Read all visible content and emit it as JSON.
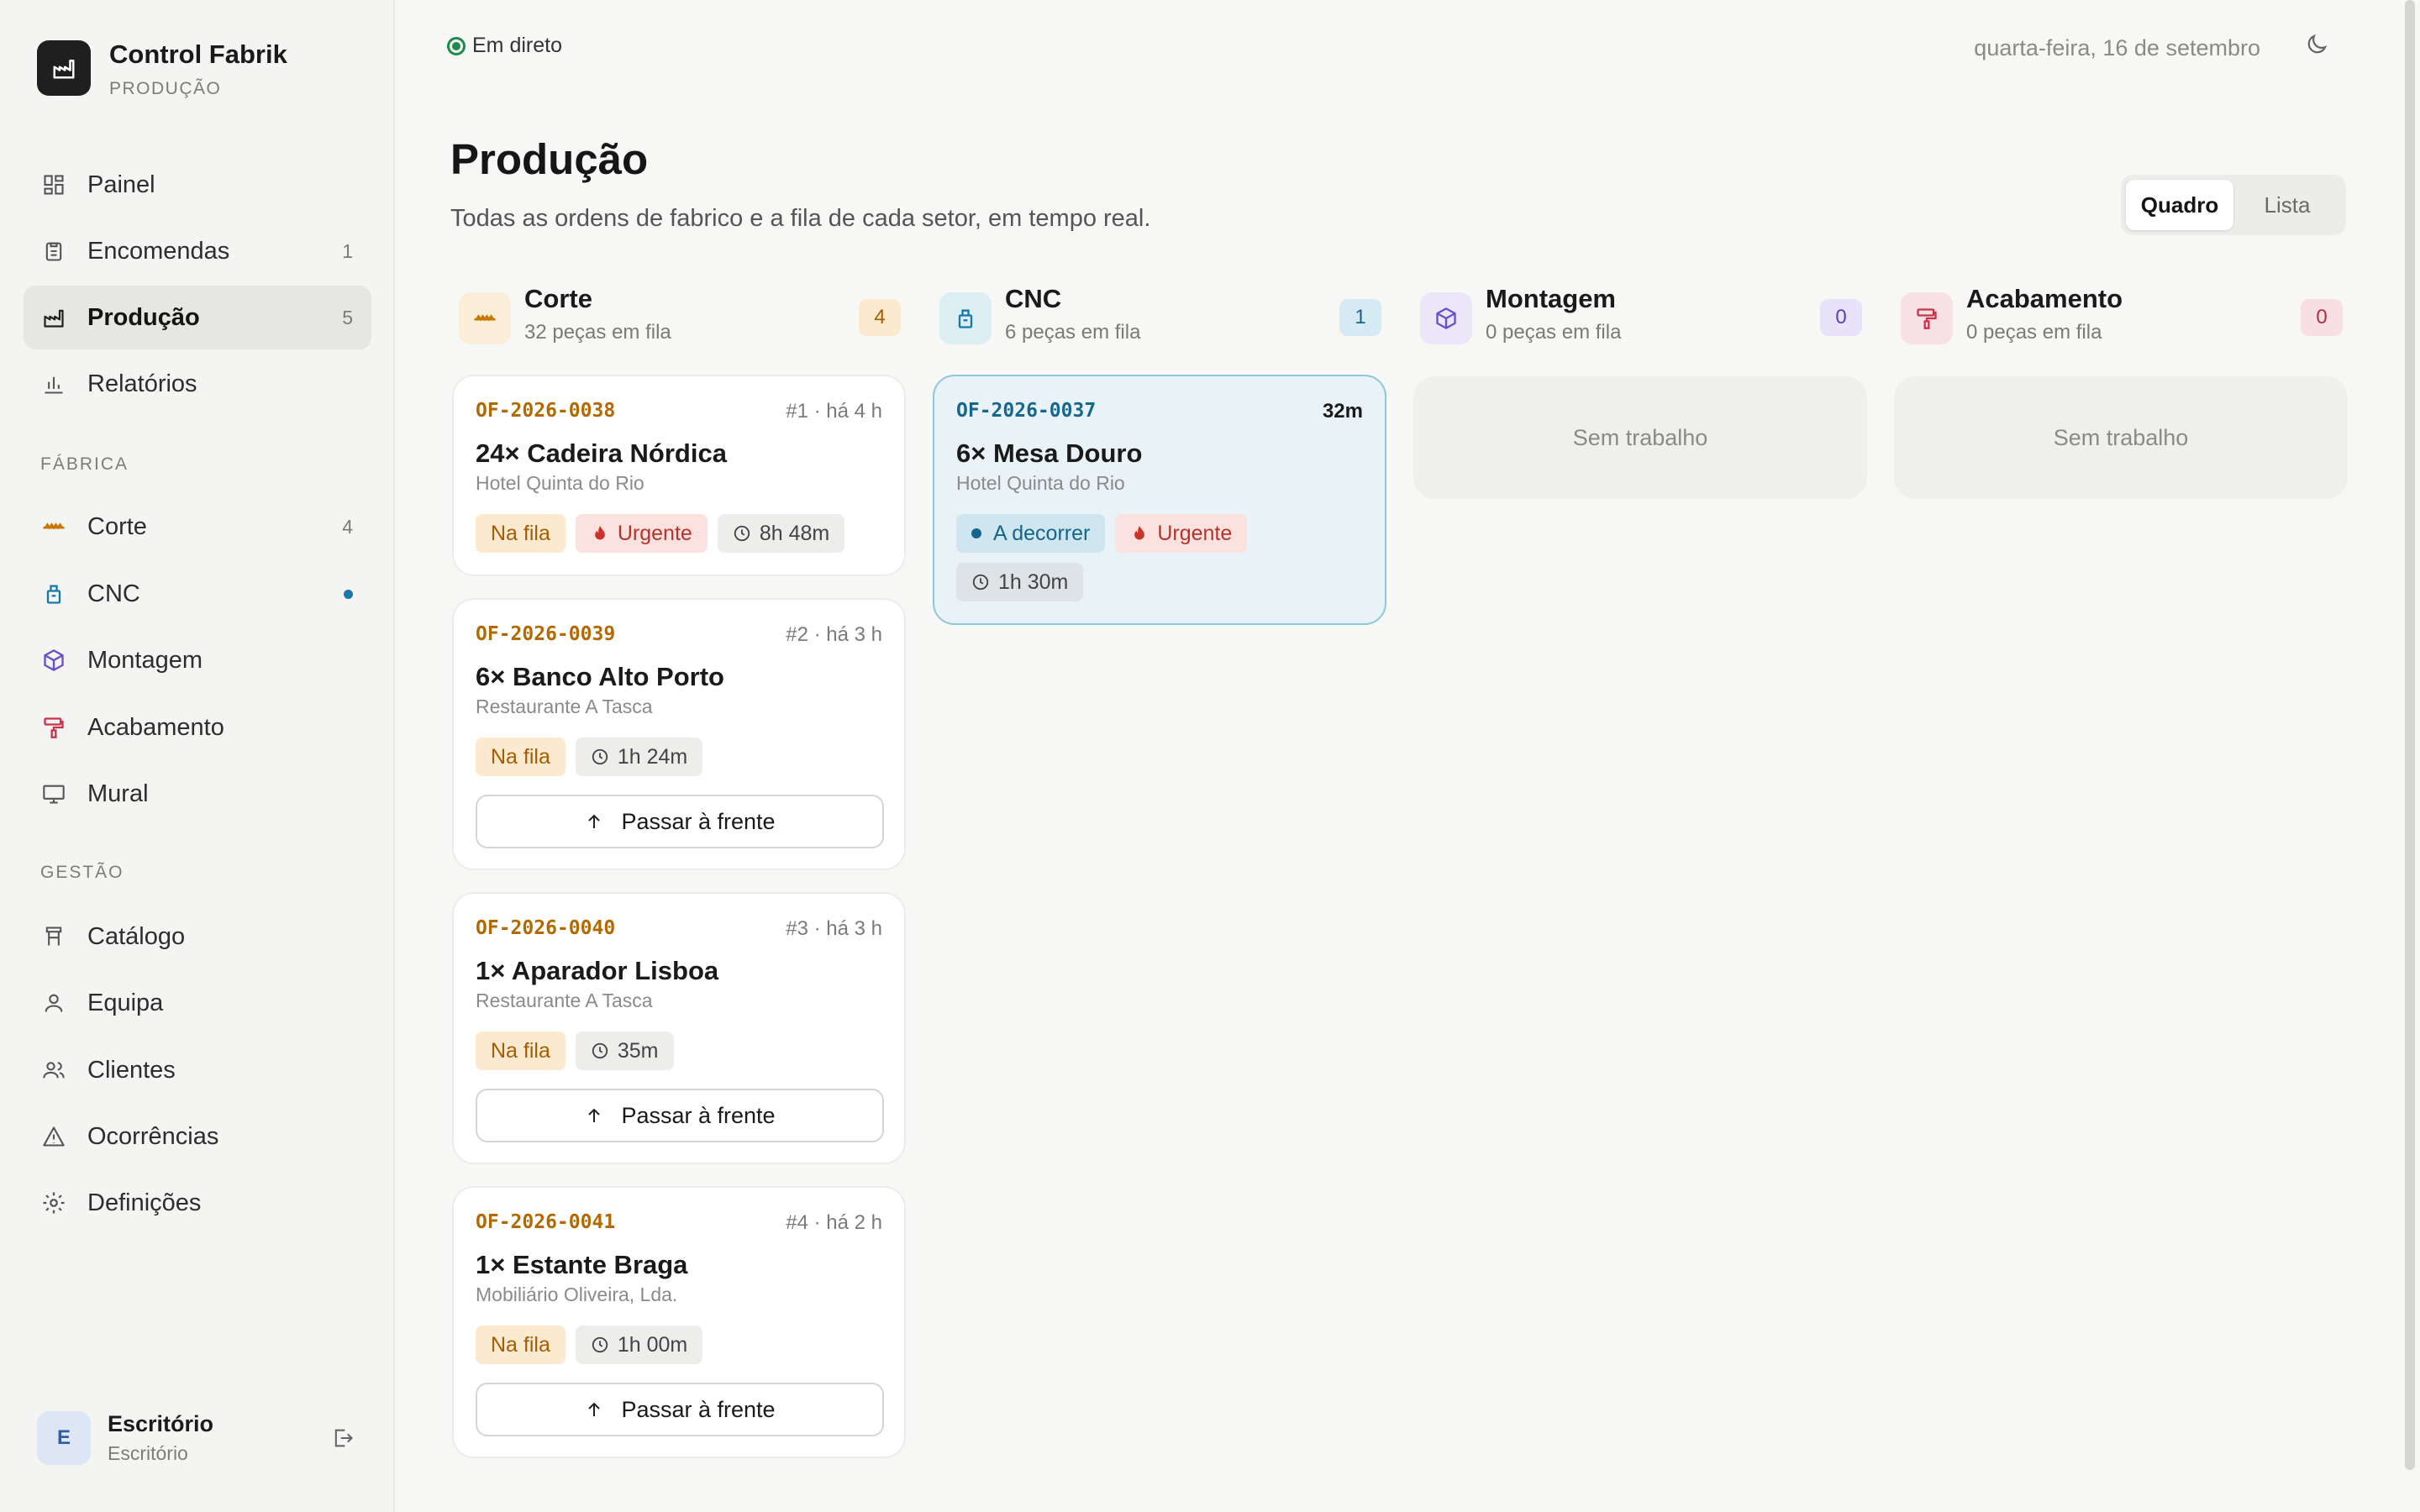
{
  "app": {
    "title": "Control Fabrik",
    "subtitle": "PRODUÇÃO"
  },
  "colors": {
    "corte": "#c77700",
    "cnc": "#1679a8",
    "montagem": "#6a4fc9",
    "acabamento": "#c8334a",
    "urgent": "#b8322a",
    "live": "#1f8a4c"
  },
  "nav": {
    "main": [
      {
        "label": "Painel",
        "icon": "dashboard-icon",
        "count": ""
      },
      {
        "label": "Encomendas",
        "icon": "clipboard-icon",
        "count": "1"
      },
      {
        "label": "Produção",
        "icon": "factory-icon",
        "count": "5"
      },
      {
        "label": "Relatórios",
        "icon": "bar-chart-icon",
        "count": ""
      }
    ],
    "fabrica_label": "FÁBRICA",
    "fabrica": [
      {
        "label": "Corte",
        "icon": "saw-icon",
        "count": "4"
      },
      {
        "label": "CNC",
        "icon": "cnc-icon",
        "status": "active"
      },
      {
        "label": "Montagem",
        "icon": "box-icon",
        "count": ""
      },
      {
        "label": "Acabamento",
        "icon": "paint-roller-icon",
        "count": ""
      },
      {
        "label": "Mural",
        "icon": "monitor-icon",
        "count": ""
      }
    ],
    "gestao_label": "GESTÃO",
    "gestao": [
      {
        "label": "Catálogo",
        "icon": "catalog-icon"
      },
      {
        "label": "Equipa",
        "icon": "user-icon"
      },
      {
        "label": "Clientes",
        "icon": "users-icon"
      },
      {
        "label": "Ocorrências",
        "icon": "warning-icon"
      },
      {
        "label": "Definições",
        "icon": "gear-icon"
      }
    ]
  },
  "user": {
    "initial": "E",
    "name": "Escritório",
    "role": "Escritório"
  },
  "topbar": {
    "live": "Em direto",
    "date": "quarta-feira, 16 de setembro"
  },
  "page": {
    "title": "Produção",
    "subtitle": "Todas as ordens de fabrico e a fila de cada setor, em tempo real.",
    "views": [
      "Quadro",
      "Lista"
    ],
    "active_view": "Quadro"
  },
  "columns": [
    {
      "name": "Corte",
      "sub": "32 peças em fila",
      "count": "4",
      "cards": [
        {
          "code": "OF-2026-0038",
          "meta": "#1 · há 4 h",
          "title": "24× Cadeira Nórdica",
          "client": "Hotel Quinta do Rio",
          "status": "Na fila",
          "urgent": "Urgente",
          "time": "8h 48m"
        },
        {
          "code": "OF-2026-0039",
          "meta": "#2 · há 3 h",
          "title": "6× Banco Alto Porto",
          "client": "Restaurante A Tasca",
          "status": "Na fila",
          "time": "1h 24m",
          "action": "Passar à frente"
        },
        {
          "code": "OF-2026-0040",
          "meta": "#3 · há 3 h",
          "title": "1× Aparador Lisboa",
          "client": "Restaurante A Tasca",
          "status": "Na fila",
          "time": "35m",
          "action": "Passar à frente"
        },
        {
          "code": "OF-2026-0041",
          "meta": "#4 · há 2 h",
          "title": "1× Estante Braga",
          "client": "Mobiliário Oliveira, Lda.",
          "status": "Na fila",
          "time": "1h 00m",
          "action": "Passar à frente"
        }
      ]
    },
    {
      "name": "CNC",
      "sub": "6 peças em fila",
      "count": "1",
      "cards": [
        {
          "code": "OF-2026-0037",
          "meta": "32m",
          "title": "6× Mesa Douro",
          "client": "Hotel Quinta do Rio",
          "status": "A decorrer",
          "urgent": "Urgente",
          "time": "1h 30m"
        }
      ]
    },
    {
      "name": "Montagem",
      "sub": "0 peças em fila",
      "count": "0",
      "empty": "Sem trabalho"
    },
    {
      "name": "Acabamento",
      "sub": "0 peças em fila",
      "count": "0",
      "empty": "Sem trabalho"
    }
  ]
}
